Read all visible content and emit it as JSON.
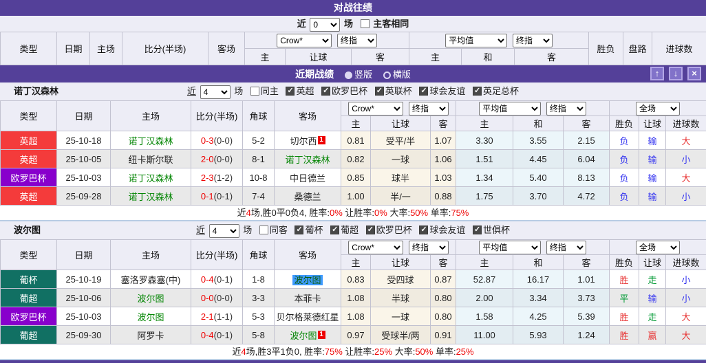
{
  "h2h": {
    "title": "对战往绩",
    "filter": {
      "near": "近",
      "count": "0",
      "unit": "场",
      "same_label": "主客相同"
    },
    "header": {
      "type": "类型",
      "date": "日期",
      "home": "主场",
      "score": "比分(半场)",
      "away": "客场",
      "odds_provider": "Crow*",
      "final_index": "终指",
      "average": "平均值",
      "home_s": "主",
      "handicap": "让球",
      "away_s": "客",
      "draw_s": "和",
      "result": "胜负",
      "trend": "盘路",
      "goals": "进球数"
    }
  },
  "recent": {
    "title": "近期战绩",
    "vertical": "竖版",
    "horizontal": "横版",
    "buttons": {
      "up": "↑",
      "down": "↓",
      "close": "×"
    }
  },
  "theader": {
    "type": "类型",
    "date": "日期",
    "home": "主场",
    "score": "比分(半场)",
    "corner": "角球",
    "away": "客场",
    "odds_provider": "Crow*",
    "final_index": "终指",
    "average": "平均值",
    "scope": "全场",
    "home_s": "主",
    "handicap": "让球",
    "away_s": "客",
    "draw_s": "和",
    "result": "胜负",
    "handicap2": "让球",
    "goals": "进球数"
  },
  "sections": [
    {
      "name": "诺丁汉森林",
      "filter": {
        "near": "近",
        "count": "4",
        "unit": "场",
        "same_label": "同主"
      },
      "leagues": [
        "英超",
        "欧罗巴杯",
        "英联杯",
        "球会友谊",
        "英足总杯"
      ],
      "rows": [
        {
          "type": "英超",
          "date": "25-10-18",
          "home": "诺丁汉森林",
          "ft": "0-3",
          "ht": "(0-0)",
          "corner": "5-2",
          "away": "切尔西",
          "away_badge": "1",
          "odds_home": "0.81",
          "odds_hcp": "受平/半",
          "odds_away": "1.07",
          "avg_home": "3.30",
          "avg_draw": "3.55",
          "avg_away": "2.15",
          "result": "负",
          "trend": "输",
          "goals": "大"
        },
        {
          "type": "英超",
          "date": "25-10-05",
          "home": "纽卡斯尔联",
          "ft": "2-0",
          "ht": "(0-0)",
          "corner": "8-1",
          "away": "诺丁汉森林",
          "odds_home": "0.82",
          "odds_hcp": "一球",
          "odds_away": "1.06",
          "avg_home": "1.51",
          "avg_draw": "4.45",
          "avg_away": "6.04",
          "result": "负",
          "trend": "输",
          "goals": "小"
        },
        {
          "type": "欧罗巴杯",
          "date": "25-10-03",
          "home": "诺丁汉森林",
          "ft": "2-3",
          "ht": "(1-2)",
          "corner": "10-8",
          "away": "中日德兰",
          "odds_home": "0.85",
          "odds_hcp": "球半",
          "odds_away": "1.03",
          "avg_home": "1.34",
          "avg_draw": "5.40",
          "avg_away": "8.13",
          "result": "负",
          "trend": "输",
          "goals": "大"
        },
        {
          "type": "英超",
          "date": "25-09-28",
          "home": "诺丁汉森林",
          "ft": "0-1",
          "ht": "(0-1)",
          "corner": "7-4",
          "away": "桑德兰",
          "odds_home": "1.00",
          "odds_hcp": "半/一",
          "odds_away": "0.88",
          "avg_home": "1.75",
          "avg_draw": "3.70",
          "avg_away": "4.72",
          "result": "负",
          "trend": "输",
          "goals": "小"
        }
      ],
      "summary": {
        "t1": "近",
        "n1": "4",
        "t2": "场,胜0平0负4, 胜率:",
        "v1": "0%",
        "t3": " 让胜率:",
        "v2": "0%",
        "t4": " 大率:",
        "v3": "50%",
        "t5": " 单率:",
        "v4": "75%"
      }
    },
    {
      "name": "波尔图",
      "filter": {
        "near": "近",
        "count": "4",
        "unit": "场",
        "same_label": "同客"
      },
      "leagues": [
        "葡杯",
        "葡超",
        "欧罗巴杯",
        "球会友谊",
        "世俱杯"
      ],
      "rows": [
        {
          "type": "葡杯",
          "date": "25-10-19",
          "home": "塞洛罗森塞(中)",
          "ft": "0-4",
          "ht": "(0-1)",
          "corner": "1-8",
          "away": "波尔图",
          "odds_home": "0.83",
          "odds_hcp": "受四球",
          "odds_away": "0.87",
          "avg_home": "52.87",
          "avg_draw": "16.17",
          "avg_away": "1.01",
          "result": "胜",
          "trend": "走",
          "goals": "小"
        },
        {
          "type": "葡超",
          "date": "25-10-06",
          "home": "波尔图",
          "ft": "0-0",
          "ht": "(0-0)",
          "corner": "3-3",
          "away": "本菲卡",
          "odds_home": "1.08",
          "odds_hcp": "半球",
          "odds_away": "0.80",
          "avg_home": "2.00",
          "avg_draw": "3.34",
          "avg_away": "3.73",
          "result": "平",
          "trend": "输",
          "goals": "小"
        },
        {
          "type": "欧罗巴杯",
          "date": "25-10-03",
          "home": "波尔图",
          "ft": "2-1",
          "ht": "(1-1)",
          "corner": "5-3",
          "away": "贝尔格莱德红星",
          "odds_home": "1.08",
          "odds_hcp": "一球",
          "odds_away": "0.80",
          "avg_home": "1.58",
          "avg_draw": "4.25",
          "avg_away": "5.39",
          "result": "胜",
          "trend": "走",
          "goals": "大"
        },
        {
          "type": "葡超",
          "date": "25-09-30",
          "home": "阿罗卡",
          "ft": "0-4",
          "ht": "(0-1)",
          "corner": "5-8",
          "away": "波尔图",
          "away_badge": "1",
          "odds_home": "0.97",
          "odds_hcp": "受球半/两",
          "odds_away": "0.91",
          "avg_home": "11.00",
          "avg_draw": "5.93",
          "avg_away": "1.24",
          "result": "胜",
          "trend": "赢",
          "goals": "大"
        }
      ],
      "summary": {
        "t1": "近",
        "n1": "4",
        "t2": "场,胜3平1负0, 胜率:",
        "v1": "75%",
        "t3": " 让胜率:",
        "v2": "25%",
        "t4": " 大率:",
        "v3": "50%",
        "t5": " 单率:",
        "v4": "25%"
      }
    }
  ]
}
